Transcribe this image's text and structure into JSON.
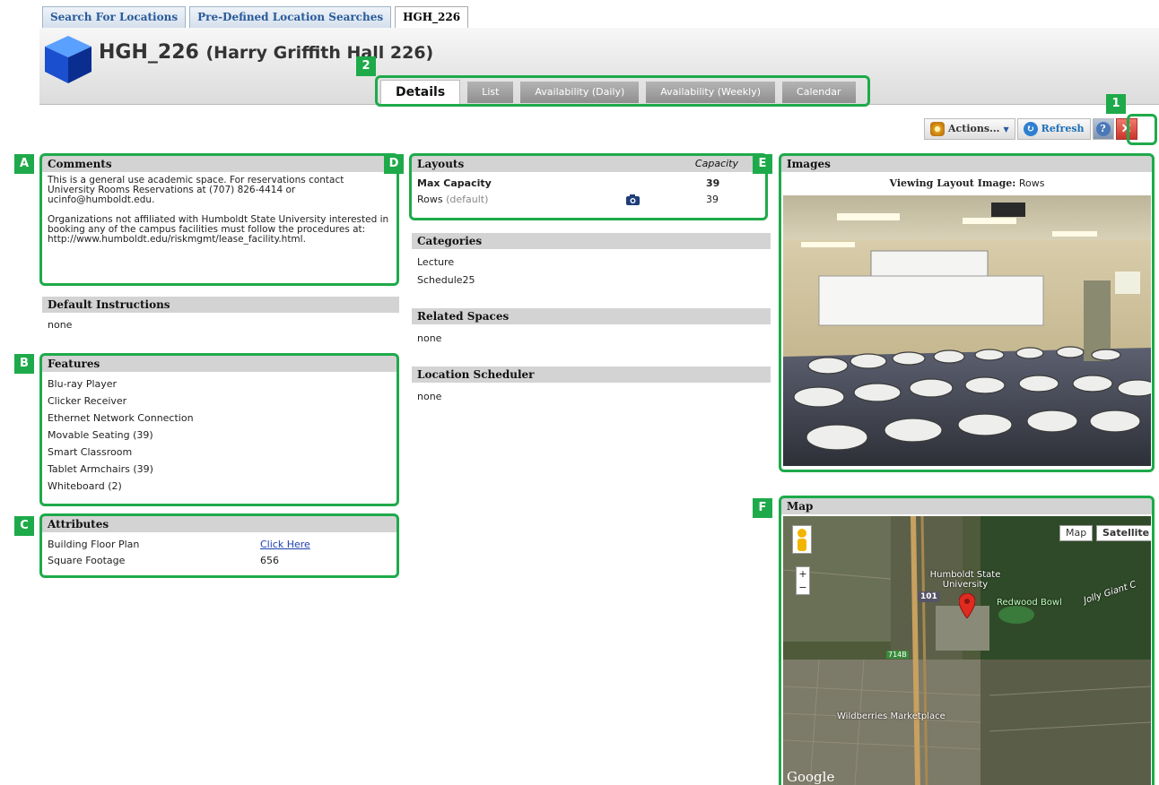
{
  "top_tabs": [
    "Search For Locations",
    "Pre-Defined Location Searches",
    "HGH_226"
  ],
  "header": {
    "title": "HGH_226",
    "subtitle": "(Harry Griffith Hall 226)"
  },
  "sub_tabs": [
    "Details",
    "List",
    "Availability (Daily)",
    "Availability (Weekly)",
    "Calendar"
  ],
  "toolbar": {
    "actions": "Actions...",
    "refresh": "Refresh"
  },
  "badges": {
    "one": "1",
    "two": "2",
    "a": "A",
    "b": "B",
    "c": "C",
    "d": "D",
    "e": "E",
    "f": "F"
  },
  "comments": {
    "title": "Comments",
    "p1": "This is a general use academic space. For reservations contact University Rooms Reservations at (707) 826-4414 or ucinfo@humboldt.edu.",
    "p2": "Organizations not affiliated with Humboldt State University interested in booking any of the campus facilities must follow the procedures at: http://www.humboldt.edu/riskmgmt/lease_facility.html."
  },
  "default_instructions": {
    "title": "Default Instructions",
    "value": "none"
  },
  "features": {
    "title": "Features",
    "items": [
      "Blu-ray Player",
      "Clicker Receiver",
      "Ethernet Network Connection",
      "Movable Seating (39)",
      "Smart Classroom",
      "Tablet Armchairs (39)",
      "Whiteboard (2)"
    ]
  },
  "attributes": {
    "title": "Attributes",
    "rows": [
      {
        "name": "Building Floor Plan",
        "value": "Click Here"
      },
      {
        "name": "Square Footage",
        "value": "656"
      }
    ]
  },
  "layouts": {
    "title": "Layouts",
    "capacity_header": "Capacity",
    "max_label": "Max Capacity",
    "max_value": "39",
    "row_name": "Rows",
    "row_default": "(default)",
    "row_value": "39"
  },
  "categories": {
    "title": "Categories",
    "items": [
      "Lecture",
      "Schedule25"
    ]
  },
  "related_spaces": {
    "title": "Related Spaces",
    "value": "none"
  },
  "location_scheduler": {
    "title": "Location Scheduler",
    "value": "none"
  },
  "images": {
    "title": "Images",
    "viewing_label": "Viewing Layout Image:",
    "viewing_value": "Rows"
  },
  "map": {
    "title": "Map",
    "btn_map": "Map",
    "btn_satellite": "Satellite",
    "labels": {
      "university": "Humboldt State University",
      "bowl": "Redwood Bowl",
      "market": "Wildberries Marketplace",
      "giant": "Jolly Giant C",
      "hwy101": "101",
      "exit": "714B",
      "google": "Google",
      "plus": "+",
      "minus": "−"
    }
  }
}
